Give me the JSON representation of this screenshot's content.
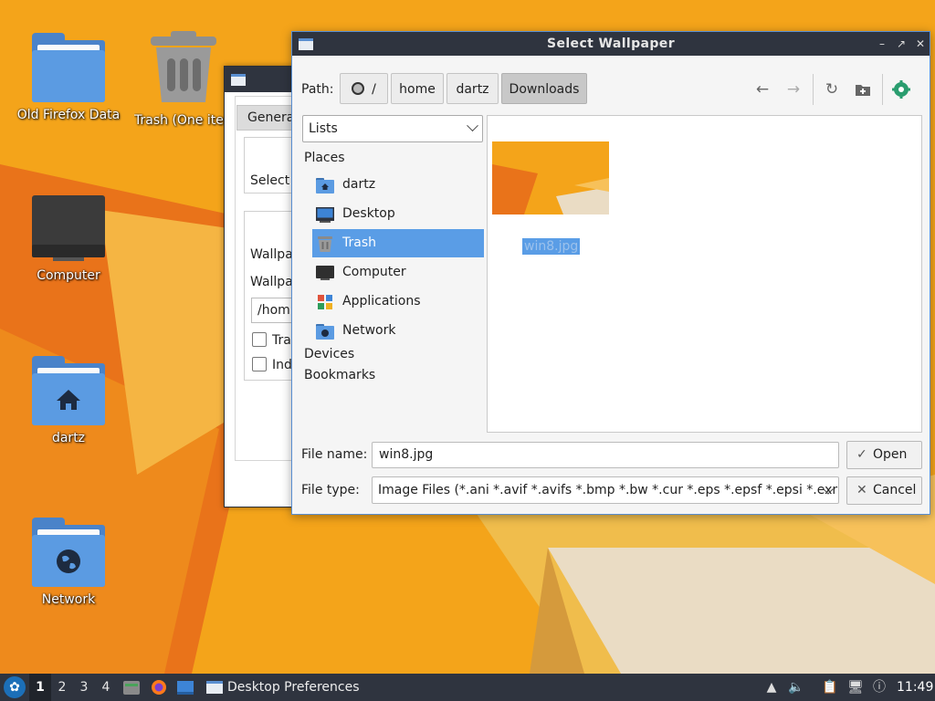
{
  "desktop": {
    "icons": [
      {
        "label": "Old Firefox Data",
        "icon": "folder-icon"
      },
      {
        "label": "Trash (One item)",
        "icon": "trash-icon"
      },
      {
        "label": "Computer",
        "icon": "computer-icon"
      },
      {
        "label": "dartz",
        "icon": "home-folder-icon"
      },
      {
        "label": "Network",
        "icon": "network-folder-icon"
      }
    ]
  },
  "prefs_window": {
    "tab_general": "General",
    "select_label": "Select",
    "wallpaper_label_1": "Wallpa",
    "wallpaper_label_2": "Wallpa",
    "path_value": "/hom",
    "check_1_label": "Tra",
    "check_2_label": "Ind"
  },
  "dialog": {
    "title": "Select Wallpaper",
    "path_label": "Path:",
    "breadcrumbs": [
      "/",
      "home",
      "dartz",
      "Downloads"
    ],
    "view_mode": "Lists",
    "places_heading": "Places",
    "places": [
      {
        "label": "dartz",
        "icon": "home-folder-icon"
      },
      {
        "label": "Desktop",
        "icon": "desktop-icon"
      },
      {
        "label": "Trash",
        "icon": "trash-icon"
      },
      {
        "label": "Computer",
        "icon": "computer-icon"
      },
      {
        "label": "Applications",
        "icon": "applications-icon"
      },
      {
        "label": "Network",
        "icon": "network-folder-icon"
      }
    ],
    "devices_heading": "Devices",
    "bookmarks_heading": "Bookmarks",
    "files": [
      {
        "name": "win8.jpg"
      }
    ],
    "filename_label": "File name:",
    "filename_value": "win8.jpg",
    "filetype_label": "File type:",
    "filetype_value": "Image Files (*.ani *.avif *.avifs *.bmp *.bw *.cur *.eps *.epsf *.epsi *.exr *",
    "open_label": "Open",
    "cancel_label": "Cancel"
  },
  "taskbar": {
    "workspaces": [
      "1",
      "2",
      "3",
      "4"
    ],
    "active_workspace": "1",
    "task_label": "Desktop Preferences",
    "clock": "11:49"
  },
  "colors": {
    "selection": "#5a9de6",
    "titlebar": "#2f343f",
    "wallpaper_orange": "#f3a81c",
    "folder_blue": "#5b9be2"
  }
}
